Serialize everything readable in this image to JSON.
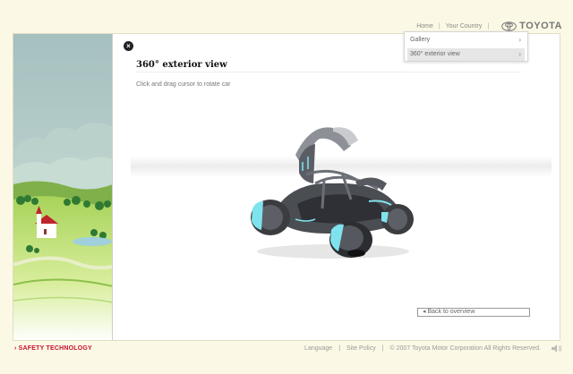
{
  "topnav": {
    "home": "Home",
    "your_country": "Your Country",
    "brand": "TOYOTA"
  },
  "menu": {
    "items": [
      {
        "label": "Gallery",
        "selected": false
      },
      {
        "label": "360° exterior view",
        "selected": true
      }
    ]
  },
  "main": {
    "close_icon": "×",
    "title": "360° exterior view",
    "instruction": "Click and drag cursor to rotate car",
    "back_label": "◂ Back to overview"
  },
  "footer": {
    "section": "› SAFETY TECHNOLOGY",
    "language": "Language",
    "site_policy": "Site Policy",
    "copyright": "© 2007 Toyota Motor Corporation All Rights Reserved."
  },
  "colors": {
    "accent_red": "#c8102e",
    "sky": "#a9c4c4",
    "grass": "#8cc04a",
    "car_glow": "#7fe3ee"
  },
  "icons": [
    "close-icon",
    "toyota-logo",
    "chevron-right-icon",
    "speaker-icon"
  ]
}
